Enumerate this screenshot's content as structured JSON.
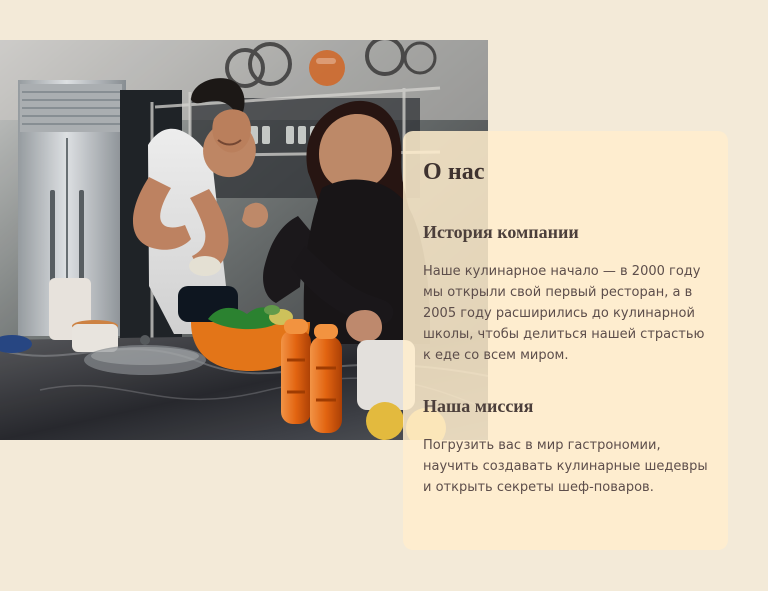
{
  "about": {
    "title": "О нас",
    "history_title": "История компании",
    "history_text": "Наше кулинарное начало — в 2000 году мы открыли свой первый ресторан, а в 2005 году расширились до кулинарной школы, чтобы делиться нашей страстью к еде со всем миром.",
    "mission_title": "Наша миссия",
    "mission_text": "Погрузить вас в мир гастрономии, научить создавать кулинарные шедевры и открыть секреты шеф-поваров."
  },
  "photo": {
    "subject": "kitchen-photo-icon",
    "accent_colors": [
      "#f07a17",
      "#e7cfa0",
      "#b6b0a8",
      "#1d1e22"
    ]
  }
}
